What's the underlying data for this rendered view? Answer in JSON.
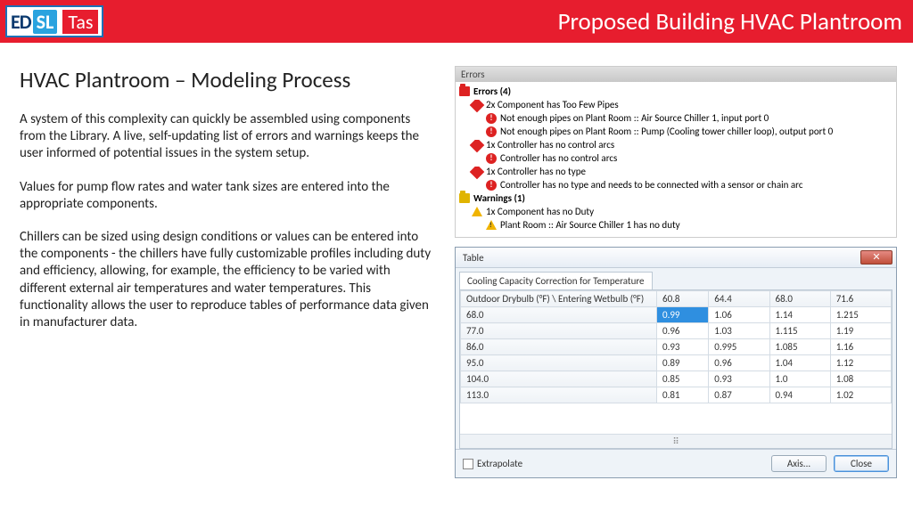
{
  "header": {
    "logo_ed": "ED",
    "logo_sl": "SL",
    "logo_tas": "Tas",
    "title": "Proposed Building HVAC Plantroom"
  },
  "left": {
    "title": "HVAC Plantroom – Modeling Process",
    "p1": "A system of this complexity can quickly be assembled using components from the Library. A live, self-updating list of errors and warnings keeps the user informed of potential issues in the system setup.",
    "p2": "Values for pump flow rates and water tank sizes are entered into the appropriate components.",
    "p3": "Chillers can be sized using design conditions or values can be entered into the components - the chillers have fully customizable profiles including duty and efficiency, allowing, for example, the efficiency to be varied with different external air temperatures and water temperatures. This functionality allows the user to reproduce tables of performance data given in manufacturer data."
  },
  "errors": {
    "header": "Errors",
    "group_errors": "Errors (4)",
    "e1": "2x Component has Too Few Pipes",
    "e1a": "Not enough pipes on Plant Room :: Air Source Chiller 1, input port 0",
    "e1b": "Not enough pipes on Plant Room :: Pump (Cooling tower chiller loop), output port 0",
    "e2": "1x Controller has no control arcs",
    "e2a": "Controller has no control arcs",
    "e3": "1x Controller has no type",
    "e3a": "Controller has no type and needs to be connected with a sensor or chain arc",
    "group_warnings": "Warnings (1)",
    "w1": "1x Component has no Duty",
    "w1a": "Plant Room :: Air Source Chiller 1 has no duty"
  },
  "table": {
    "title": "Table",
    "tab": "Cooling Capacity Correction for Temperature",
    "corner": "Outdoor Drybulb (°F) \\ Entering Wetbulb (°F)",
    "cols": [
      "60.8",
      "64.4",
      "68.0",
      "71.6"
    ],
    "rows": [
      {
        "h": "68.0",
        "c": [
          "0.99",
          "1.06",
          "1.14",
          "1.215"
        ]
      },
      {
        "h": "77.0",
        "c": [
          "0.96",
          "1.03",
          "1.115",
          "1.19"
        ]
      },
      {
        "h": "86.0",
        "c": [
          "0.93",
          "0.995",
          "1.085",
          "1.16"
        ]
      },
      {
        "h": "95.0",
        "c": [
          "0.89",
          "0.96",
          "1.04",
          "1.12"
        ]
      },
      {
        "h": "104.0",
        "c": [
          "0.85",
          "0.93",
          "1.0",
          "1.08"
        ]
      },
      {
        "h": "113.0",
        "c": [
          "0.81",
          "0.87",
          "0.94",
          "1.02"
        ]
      }
    ],
    "extrapolate": "Extrapolate",
    "axis_btn": "Axis...",
    "close_btn": "Close"
  }
}
